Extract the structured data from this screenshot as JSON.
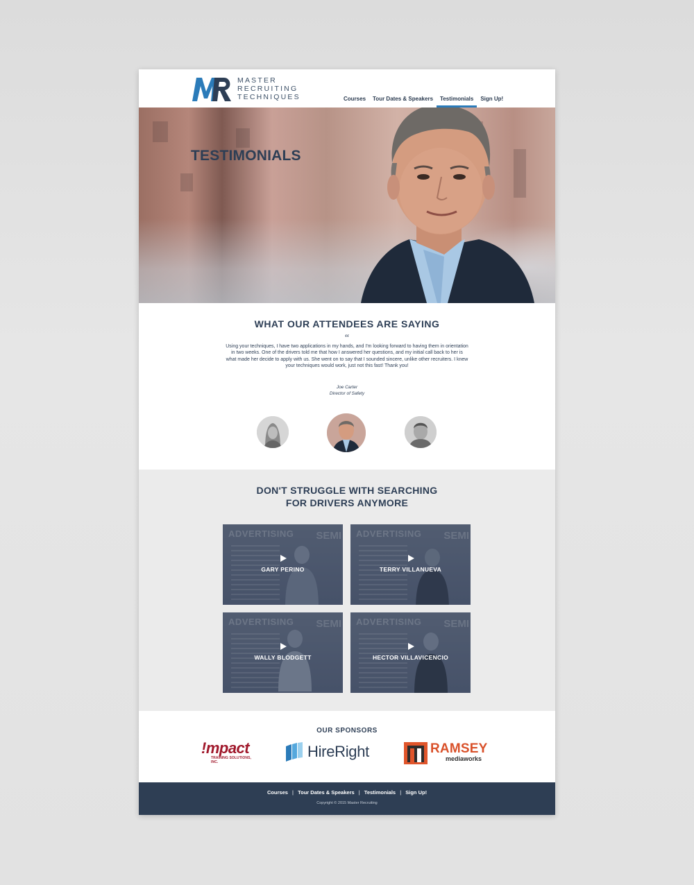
{
  "brand": {
    "logo_lines": [
      "MASTER",
      "RECRUITING",
      "TECHNIQUES"
    ],
    "colors": {
      "navy": "#2d3e55",
      "blue": "#2b7bb9",
      "footer": "#2e3e54",
      "section_gray": "#ebebeb"
    }
  },
  "nav": {
    "items": [
      {
        "label": "Courses",
        "active": false
      },
      {
        "label": "Tour Dates & Speakers",
        "active": false
      },
      {
        "label": "Testimonials",
        "active": true
      },
      {
        "label": "Sign Up!",
        "active": false
      }
    ]
  },
  "hero": {
    "title": "TESTIMONIALS"
  },
  "testimonials": {
    "title": "WHAT OUR ATTENDEES ARE SAYING",
    "quote_mark": "“",
    "quote": "Using your techniques, I have two applications in my hands, and I'm looking forward to having them in orientation in two weeks. One of the drivers told me that how I answered her questions, and my initial call back to her is what made her decide to apply with us. She went on to say that I sounded sincere, unlike other recruiters. I knew your techniques would work, just not this fast! Thank you!",
    "author_name": "Joe Carter",
    "author_title": "Director of Safety"
  },
  "videos": {
    "title_line1": "DON'T STRUGGLE WITH SEARCHING",
    "title_line2": "FOR DRIVERS ANYMORE",
    "board_text": "ADVERTISING",
    "board_text2": "SEMI",
    "items": [
      {
        "name": "GARY PERINO"
      },
      {
        "name": "TERRY VILLANUEVA"
      },
      {
        "name": "WALLY BLODGETT"
      },
      {
        "name": "HECTOR VILLAVICENCIO"
      }
    ]
  },
  "sponsors": {
    "title": "OUR SPONSORS",
    "impact": {
      "name": "!mpact",
      "sub": "TRAINING SOLUTIONS, INC."
    },
    "hireright": {
      "name": "HireRight",
      "mark": "."
    },
    "ramsey": {
      "name": "RAMSEY",
      "sub": "mediaworks"
    }
  },
  "footer": {
    "links": [
      "Courses",
      "Tour Dates & Speakers",
      "Testimonials",
      "Sign Up!"
    ],
    "separator": "|",
    "copyright": "Copyright © 2015 Master Recruiting"
  }
}
